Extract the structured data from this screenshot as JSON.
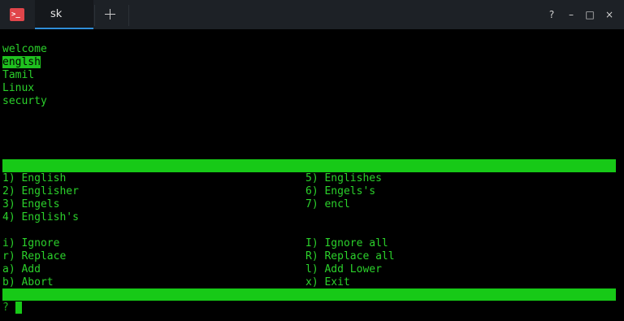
{
  "titlebar": {
    "tab_label": "sk",
    "app_icon_glyph": ">_",
    "controls": {
      "help": "?",
      "minimize": "–",
      "maximize": "□",
      "close": "×"
    }
  },
  "document_lines": [
    "welcome",
    "englsh",
    "Tamil",
    "Linux",
    "securty"
  ],
  "suggestions_left": [
    "1) English",
    "2) Englisher",
    "3) Engels",
    "4) English's"
  ],
  "suggestions_right": [
    "5) Englishes",
    "6) Engels's",
    "7) encl"
  ],
  "actions_left": [
    "i) Ignore",
    "r) Replace",
    "a) Add",
    "b) Abort"
  ],
  "actions_right": [
    "I) Ignore all",
    "R) Replace all",
    "l) Add Lower",
    "x) Exit"
  ],
  "prompt": "?",
  "colors": {
    "terminal_green": "#2bd12b",
    "bar_green": "#17c917",
    "tab_accent": "#2f8ed8",
    "app_icon": "#e0454a"
  }
}
